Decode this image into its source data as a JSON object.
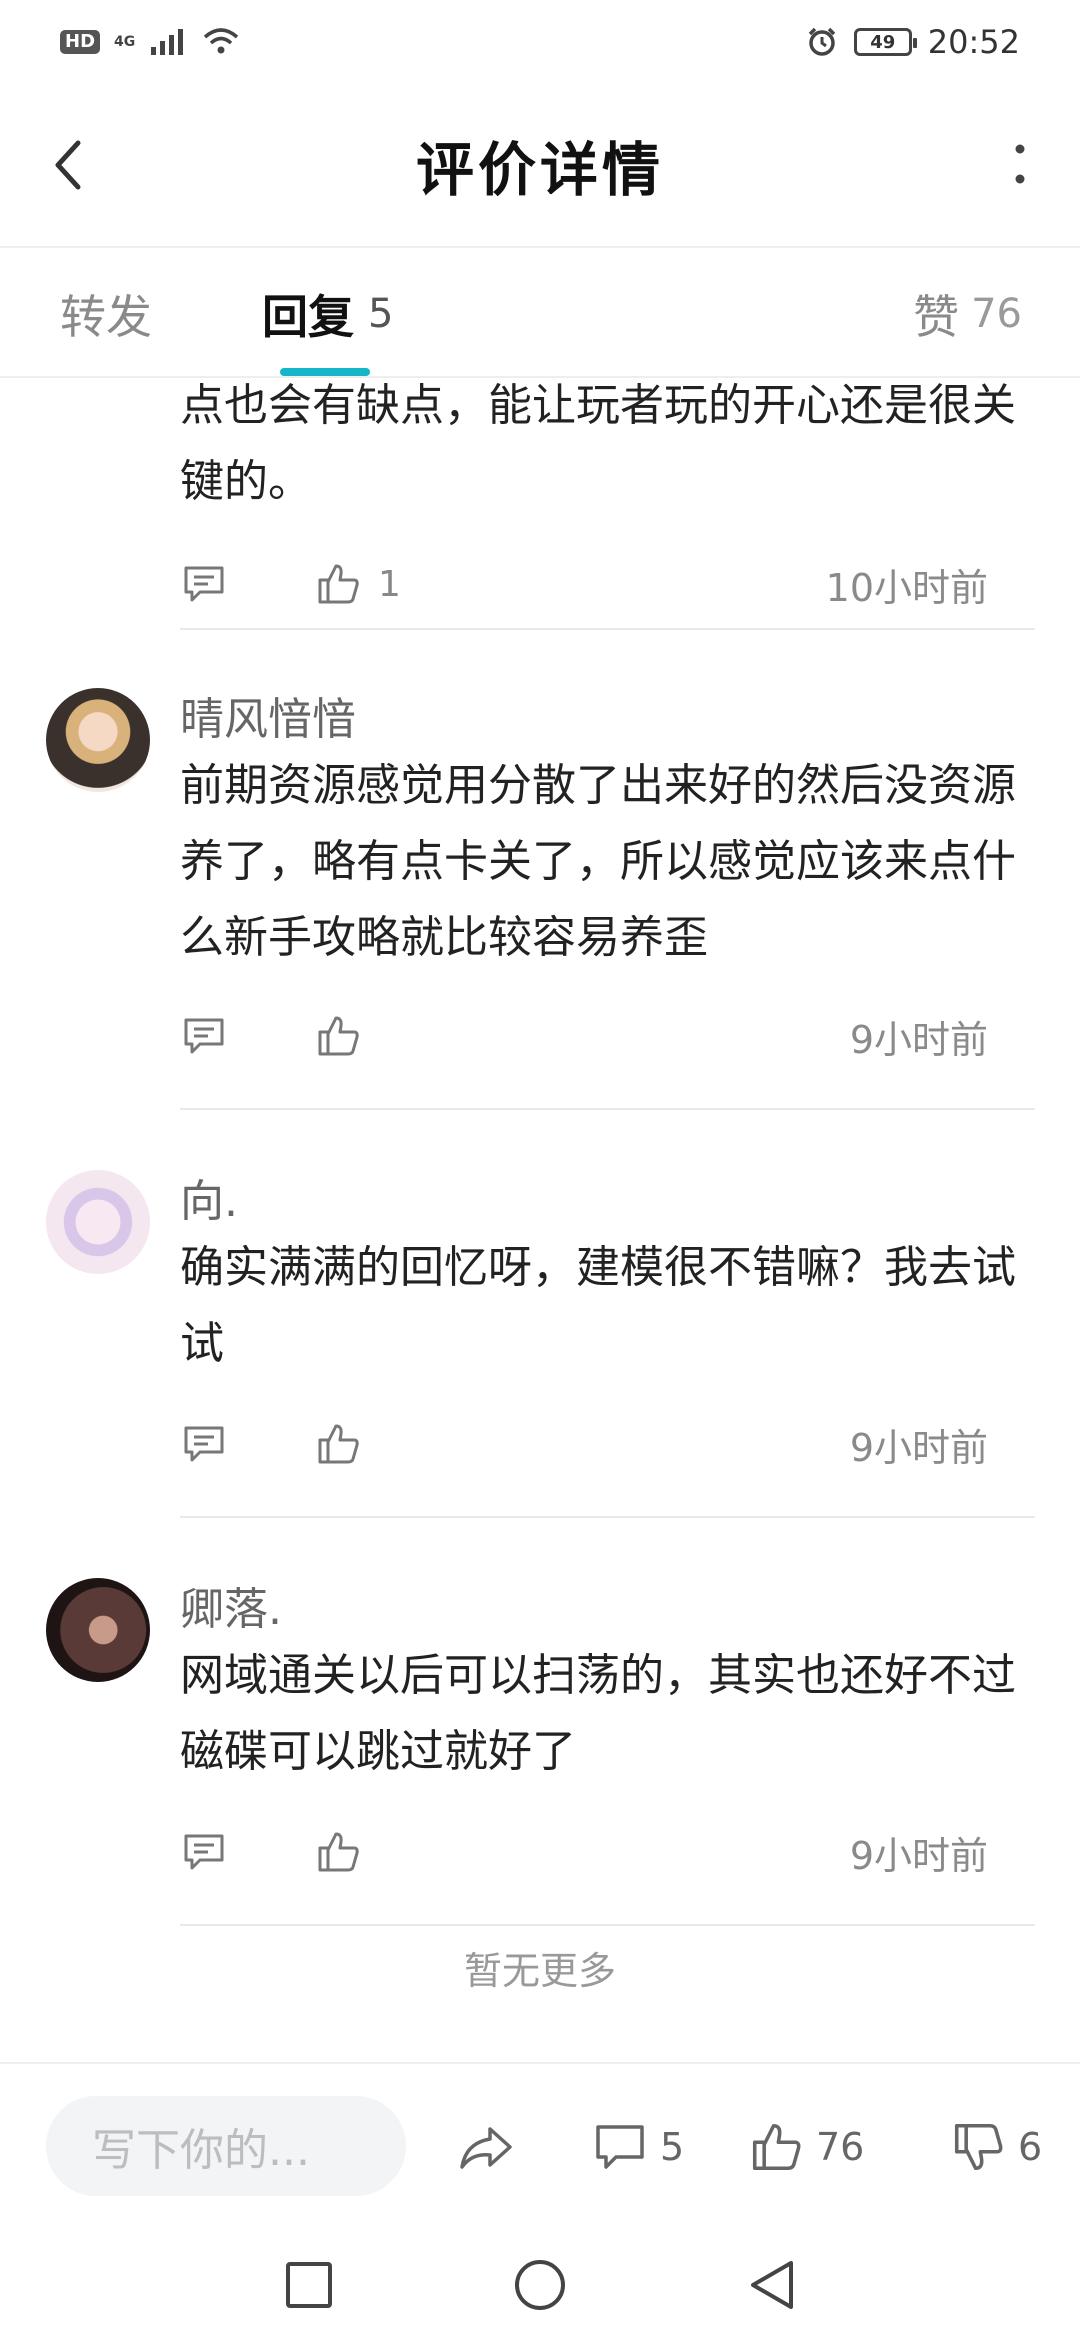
{
  "status_bar": {
    "hd": "HD",
    "network": "4G",
    "battery": "49",
    "time": "20:52"
  },
  "header": {
    "title": "评价详情"
  },
  "tabs": {
    "forward": {
      "label": "转发"
    },
    "reply": {
      "label": "回复",
      "count": "5"
    },
    "likes": {
      "label": "赞",
      "count": "76"
    }
  },
  "comments": [
    {
      "author": "",
      "text": "点也会有缺点，能让玩者玩的开心还是很关键的。",
      "likes": "1",
      "time": "10小时前"
    },
    {
      "author": "晴风愔愔",
      "text": "前期资源感觉用分散了出来好的然后没资源养了，略有点卡关了，所以感觉应该来点什么新手攻略就比较容易养歪",
      "likes": "",
      "time": "9小时前"
    },
    {
      "author": "向.",
      "text": "确实满满的回忆呀，建模很不错嘛？我去试试",
      "likes": "",
      "time": "9小时前"
    },
    {
      "author": "卿落.",
      "text": "网域通关以后可以扫荡的，其实也还好不过磁碟可以跳过就好了",
      "likes": "",
      "time": "9小时前"
    }
  ],
  "no_more": "暂无更多",
  "bottom_bar": {
    "input_placeholder": "写下你的...",
    "comment_count": "5",
    "like_count": "76",
    "dislike_count": "6"
  },
  "icons": {
    "back": "chevron-left-icon",
    "more": "more-vertical-icon",
    "reply": "comment-bubble-icon",
    "like": "thumbs-up-icon",
    "share": "share-arrow-icon",
    "dislike": "thumbs-down-icon"
  },
  "colors": {
    "accent": "#14b6c8",
    "text_primary": "#222222",
    "text_secondary": "#8a8a8a"
  }
}
